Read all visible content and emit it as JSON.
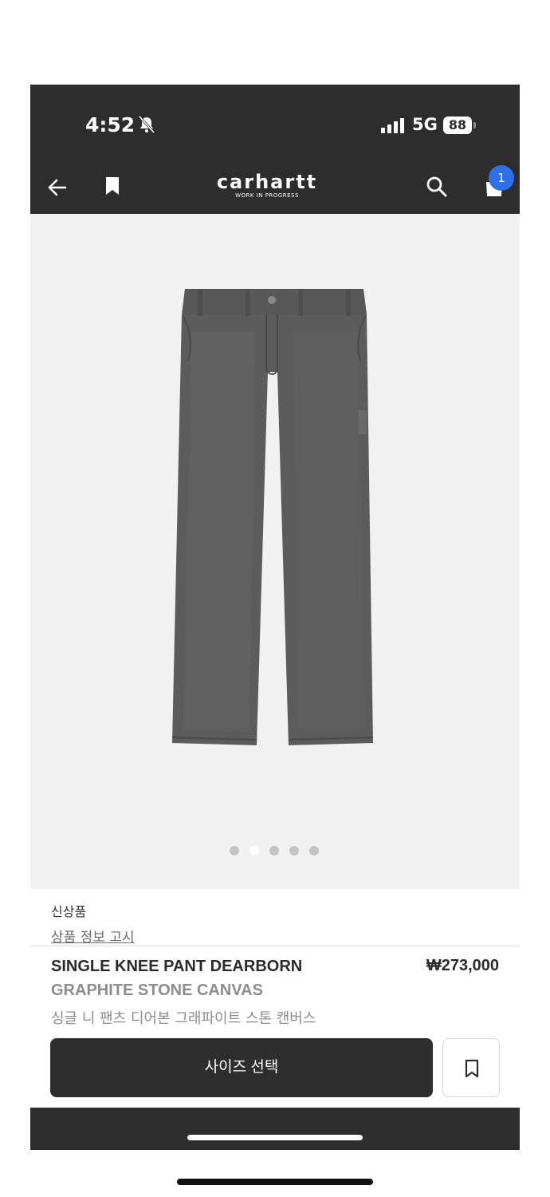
{
  "status_bar": {
    "time": "4:52",
    "network": "5G",
    "battery": "88"
  },
  "header": {
    "brand": "carhartt",
    "tagline": "WORK IN PROGRESS",
    "cart_count": "1"
  },
  "gallery": {
    "image_count": 5,
    "active_index": 1
  },
  "product": {
    "tag": "신상품",
    "notice_link": "상품 정보 고시",
    "name": "SINGLE KNEE PANT DEARBORN",
    "price": "₩273,000",
    "color": "GRAPHITE STONE CANVAS",
    "name_ko": "싱글 니 팬츠 디어본 그래파이트 스톤 캔버스"
  },
  "actions": {
    "size_select_label": "사이즈 선택"
  },
  "colors": {
    "header_bg": "#2d2d2d",
    "badge": "#2f6fe8",
    "gallery_bg": "#f1f1f1",
    "pants": "#5b5b5b"
  }
}
